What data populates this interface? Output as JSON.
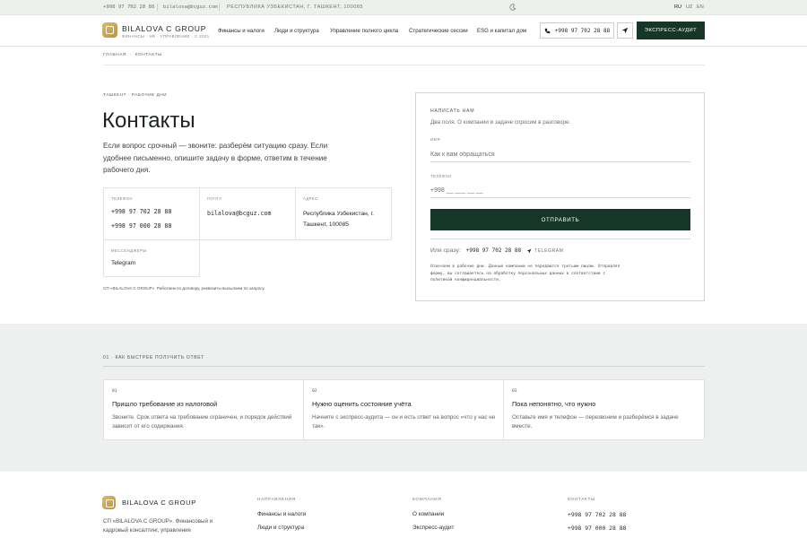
{
  "topbar": {
    "phone": "+998 97 702 28 88",
    "email": "bilalova@bcguz.com",
    "address": "РЕСПУБЛИКА УЗБЕКИСТАН, Г. ТАШКЕНТ, 100085",
    "languages": [
      "RU",
      "UZ",
      "EN"
    ]
  },
  "header": {
    "brand": "BILALOVA C GROUP",
    "brand_sub": "ФИНАНСЫ · HR · УПРАВЛЕНИЕ · С 2021",
    "nav": [
      "Финансы и налоги",
      "Люди и структура",
      "Управление полного цикла",
      "Стратегические сессии",
      "ESG и капитал дом"
    ],
    "phone_button": "+998 97 702 28 88",
    "audit_button": "ЭКСПРЕСС-АУДИТ"
  },
  "breadcrumb": [
    "ГЛАВНАЯ",
    "КОНТАКТЫ"
  ],
  "intro": {
    "eyebrow": "ТАШКЕНТ · РАБОЧИЕ ДНИ",
    "title": "Контакты",
    "lead": "Если вопрос срочный — звоните: разберём ситуацию сразу. Если удобнее письменно, опишите задачу в форме, ответим в течение рабочего дня."
  },
  "contacts": {
    "phone_label": "ТЕЛЕФОН",
    "phones": [
      "+998 97 702 28 88",
      "+998 97 000 28 88"
    ],
    "email_label": "ПОЧТА",
    "email": "bilalova@bcguz.com",
    "address_label": "АДРЕС",
    "address": "Республика Узбекистан, г. Ташкент, 100085",
    "messenger_label": "МЕССЕНДЖЕРЫ",
    "messenger": "Telegram",
    "legal": "СП «BILALOVA C GROUP». Работаем по договору, реквизиты высылаем по запросу."
  },
  "form": {
    "title": "НАПИСАТЬ НАМ",
    "subtitle": "Два поля. О компании и задаче спросим в разговоре.",
    "name_label": "ИМЯ",
    "name_placeholder": "Как к вам обращаться",
    "phone_label": "ТЕЛЕФОН",
    "phone_placeholder": "+998 __ ___ __ __",
    "submit": "ОТПРАВИТЬ",
    "alt_label": "Или сразу:",
    "alt_phone": "+998 97 702 28 88",
    "alt_telegram": "TELEGRAM",
    "note": "Отвечаем в рабочие дни. Данные компании не передаются третьим лицам. Отправляя форму, вы соглашаетесь на обработку персональных данных в соответствии с политикой конфиденциальности."
  },
  "faster": {
    "title": "01 · КАК БЫСТРЕЕ ПОЛУЧИТЬ ОТВЕТ",
    "cards": [
      {
        "num": "01",
        "title": "Пришло требование из налоговой",
        "text": "Звоните. Срок ответа на требование ограничен, и порядок действий зависит от его содержания."
      },
      {
        "num": "02",
        "title": "Нужно оценить состояние учёта",
        "text": "Начните с экспресс-аудита — он и есть ответ на вопрос «что у нас не так»."
      },
      {
        "num": "03",
        "title": "Пока непонятно, что нужно",
        "text": "Оставьте имя и телефон — перезвоним и разберёмся в задаче вместе."
      }
    ]
  },
  "footer": {
    "brand": "BILALOVA C GROUP",
    "desc": "СП «BILALOVA C GROUP». Финансовый и кадровый консалтинг, управление",
    "col1_title": "НАПРАВЛЕНИЯ",
    "col1_links": [
      "Финансы и налоги",
      "Люди и структура"
    ],
    "col2_title": "КОМПАНИЯ",
    "col2_links": [
      "О компании",
      "Экспресс-аудит"
    ],
    "col3_title": "КОНТАКТЫ",
    "col3_links": [
      "+998 97 702 28 88",
      "+998 97 000 28 88"
    ]
  },
  "colors": {
    "accent": "#163628",
    "gold": "#c9a75a",
    "muted_bg": "#edf0ee"
  }
}
